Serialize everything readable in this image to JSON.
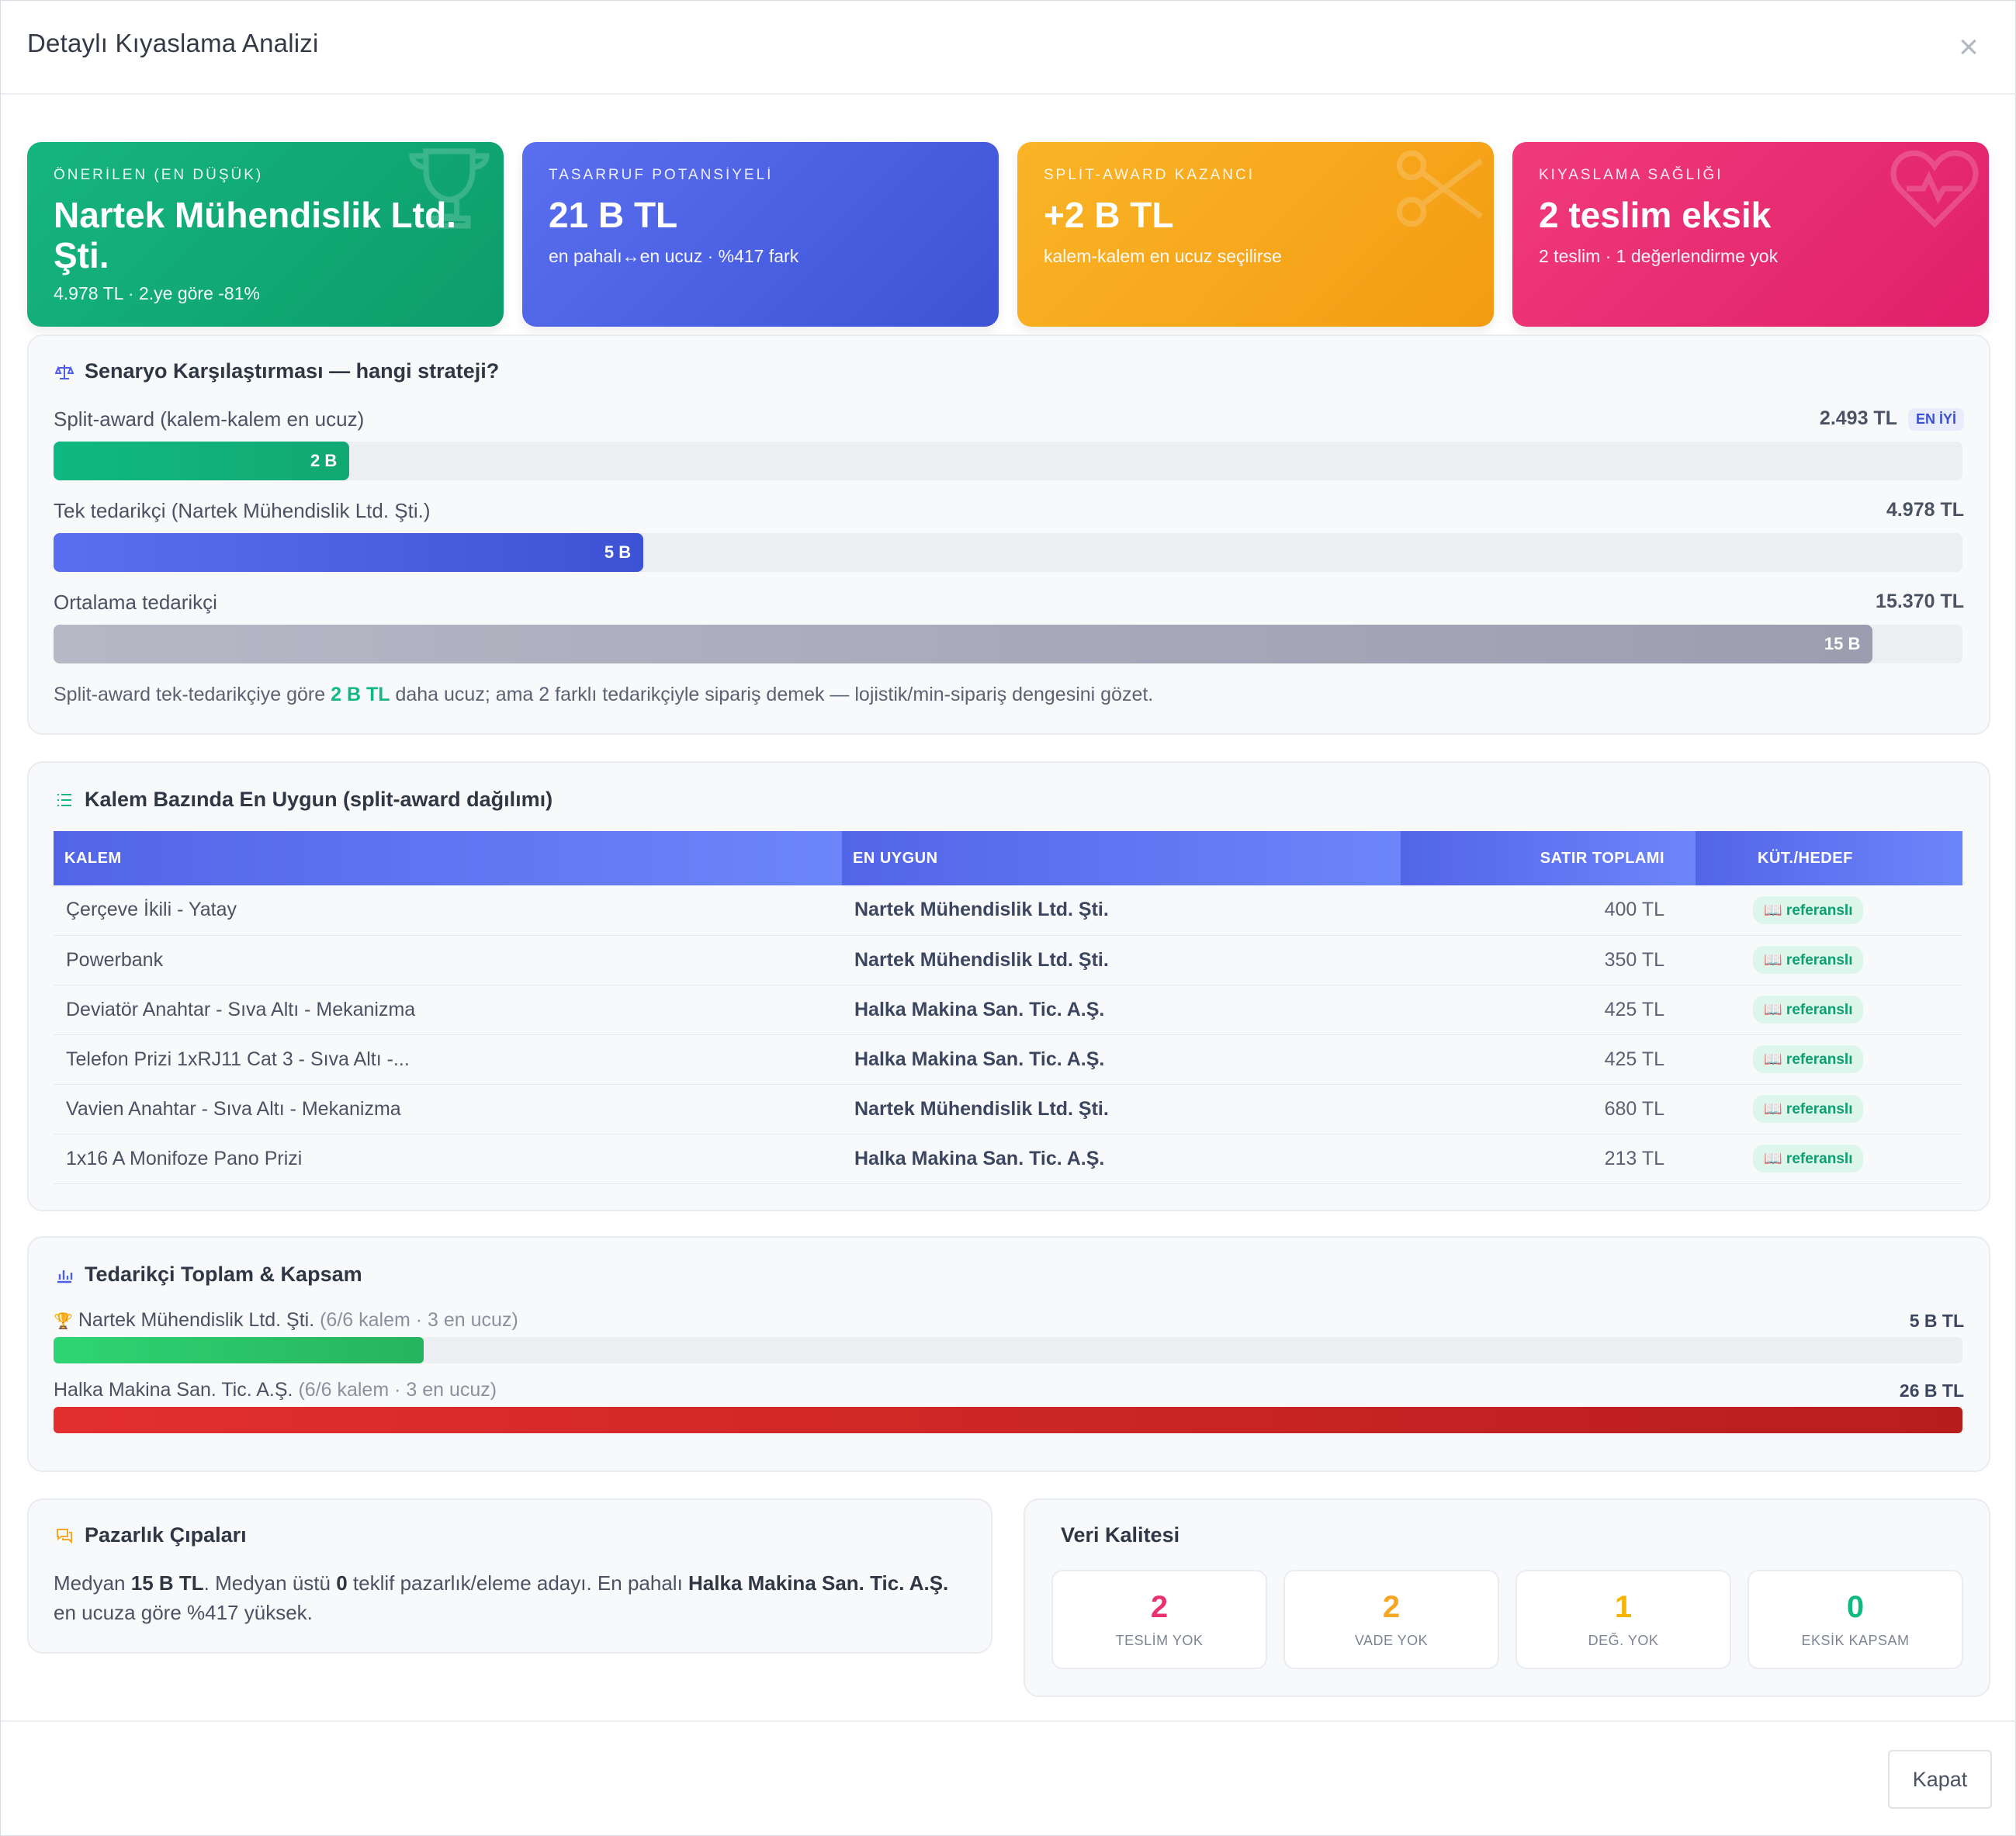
{
  "modal": {
    "title": "Detaylı Kıyaslama Analizi",
    "close_label": "×"
  },
  "kpis": [
    {
      "label": "ÖNERİLEN (EN DÜŞÜK)",
      "value": "Nartek Mühendislik Ltd. Şti.",
      "sub": "4.978 TL · 2.ye göre -81%",
      "icon": "trophy-icon"
    },
    {
      "label": "TASARRUF POTANSİYELİ",
      "value": "21 B TL",
      "sub": "en pahalı↔en ucuz · %417 fark",
      "icon": ""
    },
    {
      "label": "SPLİT-AWARD KAZANCI",
      "value": "+2 B TL",
      "sub": "kalem-kalem en ucuz seçilirse",
      "icon": "scissors-icon"
    },
    {
      "label": "KIYASLAMA SAĞLIĞI",
      "value": "2 teslim eksik",
      "sub": "2 teslim · 1 değerlendirme yok",
      "icon": "heart-pulse-icon"
    }
  ],
  "scenario": {
    "title": "Senaryo Karşılaştırması — hangi strateji?",
    "icon": "balance-scale-icon",
    "best_badge": "EN İYİ",
    "rows": [
      {
        "label": "Split-award (kalem-kalem en ucuz)",
        "value": "2.493 TL",
        "bar_label": "2 B",
        "fraction": 0.155,
        "color": "#10b981"
      },
      {
        "label": "Tek tedarikçi (Nartek Mühendislik Ltd. Şti.)",
        "value": "4.978 TL",
        "bar_label": "5 B",
        "fraction": 0.309,
        "color": "#4c5fe6"
      },
      {
        "label": "Ortalama tedarikçi",
        "value": "15.370 TL",
        "bar_label": "15 B",
        "fraction": 0.953,
        "color": "#a6a9b9"
      }
    ],
    "note_pre": "Split-award tek-tedarikçiye göre ",
    "note_hl": "2 B TL",
    "note_post": " daha ucuz; ama 2 farklı tedarikçiyle sipariş demek — lojistik/min-sipariş dengesini gözet."
  },
  "items": {
    "title": "Kalem Bazında En Uygun (split-award dağılımı)",
    "icon": "list-icon",
    "headers": [
      "KALEM",
      "EN UYGUN",
      "SATIR TOPLAMI",
      "KÜT./HEDEF"
    ],
    "rows": [
      {
        "item": "Çerçeve İkili - Yatay",
        "supplier": "Nartek Mühendislik Ltd. Şti.",
        "total": "400 TL",
        "badge": "📖 referanslı"
      },
      {
        "item": "Powerbank",
        "supplier": "Nartek Mühendislik Ltd. Şti.",
        "total": "350 TL",
        "badge": "📖 referanslı"
      },
      {
        "item": "Deviatör Anahtar - Sıva Altı - Mekanizma",
        "supplier": "Halka Makina San. Tic. A.Ş.",
        "total": "425 TL",
        "badge": "📖 referanslı"
      },
      {
        "item": "Telefon Prizi 1xRJ11 Cat 3 - Sıva Altı -...",
        "supplier": "Halka Makina San. Tic. A.Ş.",
        "total": "425 TL",
        "badge": "📖 referanslı"
      },
      {
        "item": "Vavien Anahtar - Sıva Altı - Mekanizma",
        "supplier": "Nartek Mühendislik Ltd. Şti.",
        "total": "680 TL",
        "badge": "📖 referanslı"
      },
      {
        "item": "1x16 A Monifoze Pano Prizi",
        "supplier": "Halka Makina San. Tic. A.Ş.",
        "total": "213 TL",
        "badge": "📖 referanslı"
      }
    ]
  },
  "suppliers": {
    "title": "Tedarikçi Toplam & Kapsam",
    "icon": "bar-chart-icon",
    "rows": [
      {
        "name": "Nartek Mühendislik Ltd. Şti.",
        "meta": "(6/6 kalem · 3 en ucuz)",
        "value": "5 B TL",
        "fraction": 0.194,
        "trophy": true,
        "color": "#2ecc71"
      },
      {
        "name": "Halka Makina San. Tic. A.Ş.",
        "meta": "(6/6 kalem · 3 en ucuz)",
        "value": "26 B TL",
        "fraction": 1.0,
        "trophy": false,
        "color": "#d62828"
      }
    ]
  },
  "negotiation": {
    "title": "Pazarlık Çıpaları",
    "icon": "chat-icon",
    "t1": "Medyan ",
    "b1": "15 B TL",
    "t2": ". Medyan üstü ",
    "b2": "0",
    "t3": " teklif pazarlık/eleme adayı. En pahalı ",
    "b3": "Halka Makina San. Tic. A.Ş.",
    "t4": " en ucuza göre %417 yüksek."
  },
  "data_quality": {
    "title": "Veri Kalitesi",
    "cards": [
      {
        "num": "2",
        "label": "TESLİM YOK",
        "color": "#e8336f"
      },
      {
        "num": "2",
        "label": "VADE YOK",
        "color": "#f5a623"
      },
      {
        "num": "1",
        "label": "DEĞ. YOK",
        "color": "#f5b400"
      },
      {
        "num": "0",
        "label": "EKSİK KAPSAM",
        "color": "#10b981"
      }
    ]
  },
  "footer": {
    "close_button": "Kapat"
  }
}
